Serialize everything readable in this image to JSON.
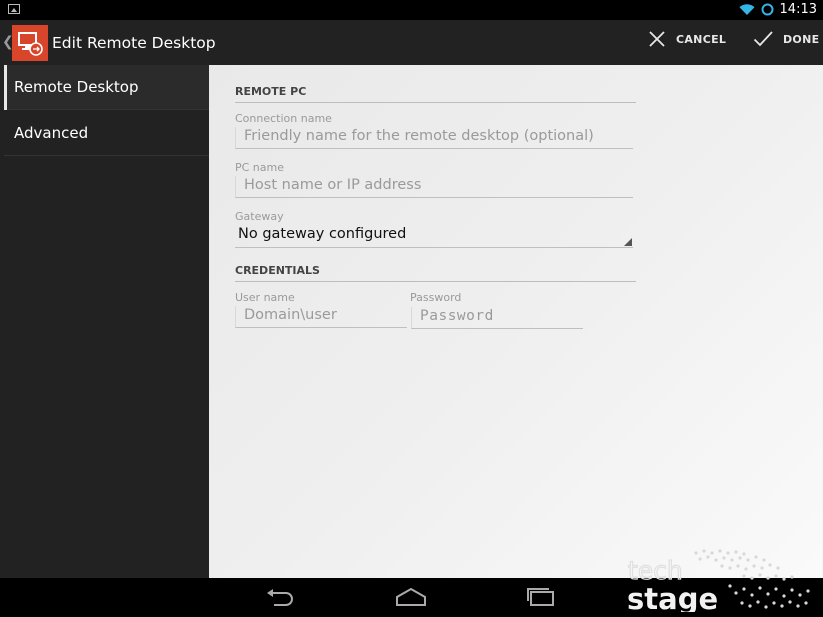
{
  "status_bar": {
    "time": "14:13",
    "icons": [
      "gallery-icon",
      "wifi-icon",
      "sync-icon"
    ]
  },
  "action_bar": {
    "title": "Edit Remote Desktop",
    "cancel_label": "CANCEL",
    "done_label": "DONE",
    "accent_color": "#d9452a"
  },
  "sidebar": {
    "items": [
      {
        "label": "Remote Desktop",
        "selected": true
      },
      {
        "label": "Advanced",
        "selected": false
      }
    ]
  },
  "form": {
    "remote_pc": {
      "header": "REMOTE PC",
      "connection_name": {
        "label": "Connection name",
        "value": "",
        "placeholder": "Friendly name for the remote desktop (optional)"
      },
      "pc_name": {
        "label": "PC name",
        "value": "",
        "placeholder": "Host name or IP address"
      },
      "gateway": {
        "label": "Gateway",
        "value": "No gateway configured"
      }
    },
    "credentials": {
      "header": "CREDENTIALS",
      "user_name": {
        "label": "User name",
        "value": "",
        "placeholder": "Domain\\user"
      },
      "password": {
        "label": "Password",
        "value": "",
        "placeholder": "Password"
      }
    }
  },
  "navigation_bar": {
    "icons": [
      "back-icon",
      "home-icon",
      "recents-icon"
    ]
  },
  "watermark": {
    "line1": "tech",
    "line2": "stage"
  }
}
